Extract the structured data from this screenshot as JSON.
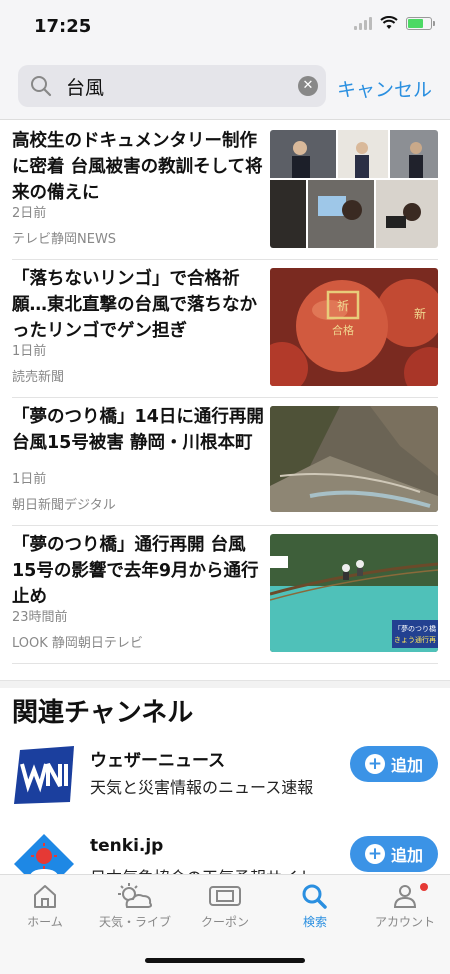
{
  "status": {
    "time": "17:25"
  },
  "search": {
    "query": "台風",
    "cancel_label": "キャンセル"
  },
  "news": [
    {
      "title": "高校生のドキュメンタリー制作に密着 台風被害の教訓そして将来の備えに",
      "date": "2日前",
      "source": "テレビ静岡NEWS"
    },
    {
      "title": "「落ちないリンゴ」で合格祈願…東北直撃の台風で落ちなかったリンゴでゲン担ぎ",
      "date": "1日前",
      "source": "読売新聞"
    },
    {
      "title": "「夢のつり橋」14日に通行再開 台風15号被害 静岡・川根本町",
      "date": "1日前",
      "source": "朝日新聞デジタル"
    },
    {
      "title": "「夢のつり橋」通行再開 台風15号の影響で去年9月から通行止め",
      "date": "23時間前",
      "source": "LOOK 静岡朝日テレビ"
    }
  ],
  "thumb_text": {
    "apple_1": "祈",
    "apple_2": "合格",
    "apple_3": "新",
    "bridge_caption_1": "「夢のつり橋",
    "bridge_caption_2": "きょう通行再"
  },
  "channels": {
    "heading": "関連チャンネル",
    "items": [
      {
        "name": "ウェザーニュース",
        "desc": "天気と災害情報のニュース速報",
        "add_label": "追加"
      },
      {
        "name": "tenki.jp",
        "desc": "日本気象協会の天気予報サイト",
        "add_label": "追加"
      }
    ]
  },
  "tabs": [
    {
      "label": "ホーム"
    },
    {
      "label": "天気・ライブ"
    },
    {
      "label": "クーポン"
    },
    {
      "label": "検索"
    },
    {
      "label": "アカウント"
    }
  ],
  "colors": {
    "accent": "#2a8fe0",
    "add_button": "#3b93e6",
    "badge": "#e53935"
  }
}
